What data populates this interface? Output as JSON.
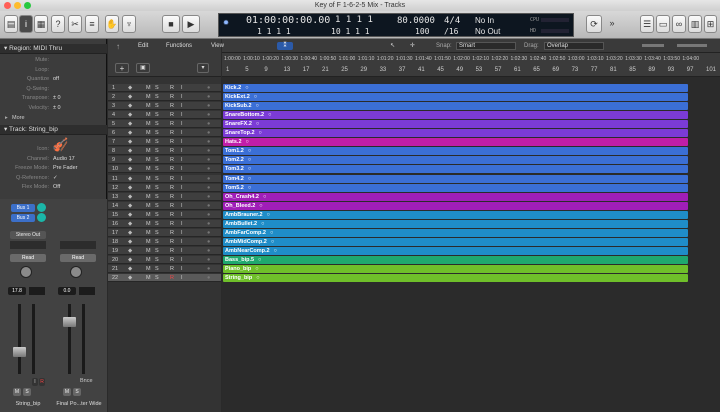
{
  "window": {
    "title": "Key of F 1-6-2-5 Mix - Tracks"
  },
  "lcd": {
    "time": "01:00:00:00.00",
    "time_sub": "1  1  1    1",
    "bars": "1  1  1    1",
    "bars_sub": "10  1  1  1",
    "tempo": "80.0000",
    "tempo_sub": "100",
    "signature": "4/4",
    "signature_sub": "/16",
    "midi_in": "No In",
    "midi_out": "No Out",
    "cpu": "CPU",
    "hd": "HD"
  },
  "inspector": {
    "region_header": "Region: MIDI Thru",
    "region_params": [
      {
        "label": "Mute:",
        "value": ""
      },
      {
        "label": "Loop:",
        "value": ""
      },
      {
        "label": "Quantize",
        "value": "off"
      },
      {
        "label": "Q-Swing:",
        "value": ""
      },
      {
        "label": "Transpose:",
        "value": "± 0"
      },
      {
        "label": "Velocity:",
        "value": "± 0"
      }
    ],
    "more": "More",
    "track_header": "Track:  String_bip",
    "track_params": [
      {
        "label": "Icon:",
        "value": ""
      },
      {
        "label": "Channel:",
        "value": "Audio 17"
      },
      {
        "label": "Freeze Mode:",
        "value": "Pre Fader"
      },
      {
        "label": "Q-Reference:",
        "value": "✓"
      },
      {
        "label": "Flex Mode:",
        "value": "Off"
      }
    ]
  },
  "strips": {
    "left": {
      "send1": "Bus 1",
      "send2": "Bus 2",
      "output": "Stereo Out",
      "automation": "Read",
      "volume": "17.8",
      "m": "M",
      "s": "S",
      "i": "I",
      "r": "R",
      "name": "String_bip"
    },
    "right": {
      "automation": "Read",
      "volume": "0.0",
      "bnce": "Bnce",
      "m": "M",
      "s": "S",
      "name": "Final Po...ter Wide"
    }
  },
  "arrange_bar": {
    "edit": "Edit",
    "functions": "Functions",
    "view": "View",
    "snap_label": "Snap:",
    "snap_value": "Smart",
    "drag_label": "Drag:",
    "drag_value": "Overlap"
  },
  "ruler": {
    "times": [
      "1:00:00",
      "1:00:10",
      "1:00:20",
      "1:00:30",
      "1:00:40",
      "1:00:50",
      "1:01:00",
      "1:01:10",
      "1:01:20",
      "1:01:30",
      "1:01:40",
      "1:01:50",
      "1:02:00",
      "1:02:10",
      "1:02:20",
      "1:02:30",
      "1:02:40",
      "1:02:50",
      "1:03:00",
      "1:03:10",
      "1:03:20",
      "1:03:30",
      "1:03:40",
      "1:03:50",
      "1:04:00"
    ],
    "bars": [
      "1",
      "5",
      "9",
      "13",
      "17",
      "21",
      "25",
      "29",
      "33",
      "37",
      "41",
      "45",
      "49",
      "53",
      "57",
      "61",
      "65",
      "69",
      "73",
      "77",
      "81",
      "85",
      "89",
      "93",
      "97",
      "101"
    ]
  },
  "tracks": [
    {
      "num": "1",
      "region": "Kick.2",
      "color": "#3b6fd6"
    },
    {
      "num": "2",
      "region": "KickExt.2",
      "color": "#3b6fd6"
    },
    {
      "num": "3",
      "region": "KickSub.2",
      "color": "#3b6fd6"
    },
    {
      "num": "4",
      "region": "SnareBottom.2",
      "color": "#7b3bd6"
    },
    {
      "num": "5",
      "region": "SnareFX.2",
      "color": "#7b3bd6"
    },
    {
      "num": "6",
      "region": "SnareTop.2",
      "color": "#7b3bd6"
    },
    {
      "num": "7",
      "region": "Hats.2",
      "color": "#c01ea8"
    },
    {
      "num": "8",
      "region": "Tom1.2",
      "color": "#3b6fd6"
    },
    {
      "num": "9",
      "region": "Tom2.2",
      "color": "#3b6fd6"
    },
    {
      "num": "10",
      "region": "Tom3.2",
      "color": "#3b6fd6"
    },
    {
      "num": "11",
      "region": "Tom4.2",
      "color": "#3b6fd6"
    },
    {
      "num": "12",
      "region": "Tom5.2",
      "color": "#3b6fd6"
    },
    {
      "num": "13",
      "region": "Oh_Crash4.2",
      "color": "#a01eb8"
    },
    {
      "num": "14",
      "region": "Oh_Bleed.2",
      "color": "#a01eb8"
    },
    {
      "num": "15",
      "region": "AmbBrauner.2",
      "color": "#1f8dc8"
    },
    {
      "num": "16",
      "region": "AmbBullet.2",
      "color": "#1f8dc8"
    },
    {
      "num": "17",
      "region": "AmbFarComp.2",
      "color": "#1f8dc8"
    },
    {
      "num": "18",
      "region": "AmbMidComp.2",
      "color": "#1f8dc8"
    },
    {
      "num": "19",
      "region": "AmbNearComp.2",
      "color": "#1f8dc8"
    },
    {
      "num": "20",
      "region": "Bass_bip.5",
      "color": "#1fa86e"
    },
    {
      "num": "21",
      "region": "Piano_bip",
      "color": "#6fbf2a"
    },
    {
      "num": "22",
      "region": "String_bip",
      "color": "#6fbf2a"
    }
  ],
  "track_buttons": {
    "m": "M",
    "s": "S",
    "r": "R",
    "i": "I"
  }
}
